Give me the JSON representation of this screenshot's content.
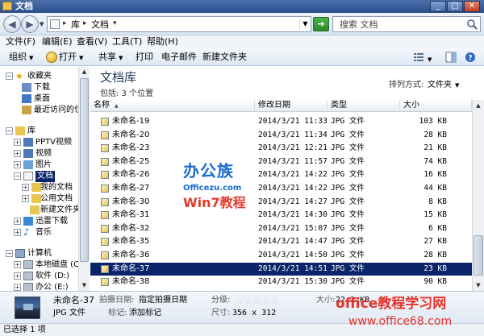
{
  "window": {
    "title": "文档"
  },
  "address": {
    "crumbs": [
      "库",
      "文档"
    ]
  },
  "search": {
    "placeholder": "搜索 文档"
  },
  "menu": [
    "文件(F)",
    "编辑(E)",
    "查看(V)",
    "工具(T)",
    "帮助(H)"
  ],
  "commands": {
    "organize": "组织",
    "open": "打开",
    "share": "共享",
    "print": "打印",
    "email": "电子邮件",
    "new_folder": "新建文件夹"
  },
  "nav": {
    "favorites": "收藏夹",
    "downloads": "下载",
    "desktop": "桌面",
    "recent": "最近访问的位置",
    "libraries": "库",
    "pptv": "PPTV视频",
    "videos": "视频",
    "pictures": "图片",
    "documents": "文档",
    "my_documents": "我的文档",
    "public_documents": "公用文档",
    "new_folder": "新建文件夹",
    "xunlei": "迅雷下载",
    "music": "音乐",
    "computer": "计算机",
    "local_disk": "本地磁盘 (C:)",
    "software": "软件 (D:)",
    "office": "办公 (E:)"
  },
  "library": {
    "title": "文档库",
    "includes": "包括: 3 个位置",
    "arrange_label": "排列方式:",
    "arrange_value": "文件夹"
  },
  "columns": {
    "name": "名称",
    "date": "修改日期",
    "type": "类型",
    "size": "大小"
  },
  "files": [
    {
      "name": "未命名-19",
      "date": "2014/3/21 11:33",
      "type": "JPG 文件",
      "size": "103 KB"
    },
    {
      "name": "未命名-20",
      "date": "2014/3/21 11:34",
      "type": "JPG 文件",
      "size": "28 KB"
    },
    {
      "name": "未命名-23",
      "date": "2014/3/21 12:21",
      "type": "JPG 文件",
      "size": "21 KB"
    },
    {
      "name": "未命名-25",
      "date": "2014/3/21 11:57",
      "type": "JPG 文件",
      "size": "74 KB"
    },
    {
      "name": "未命名-26",
      "date": "2014/3/21 14:22",
      "type": "JPG 文件",
      "size": "16 KB"
    },
    {
      "name": "未命名-27",
      "date": "2014/3/21 14:22",
      "type": "JPG 文件",
      "size": "44 KB"
    },
    {
      "name": "未命名-30",
      "date": "2014/3/21 14:27",
      "type": "JPG 文件",
      "size": "8 KB"
    },
    {
      "name": "未命名-31",
      "date": "2014/3/21 14:30",
      "type": "JPG 文件",
      "size": "15 KB"
    },
    {
      "name": "未命名-32",
      "date": "2014/3/21 15:07",
      "type": "JPG 文件",
      "size": "6 KB"
    },
    {
      "name": "未命名-35",
      "date": "2014/3/21 14:47",
      "type": "JPG 文件",
      "size": "27 KB"
    },
    {
      "name": "未命名-36",
      "date": "2014/3/21 14:50",
      "type": "JPG 文件",
      "size": "28 KB"
    },
    {
      "name": "未命名-37",
      "date": "2014/3/21 14:51",
      "type": "JPG 文件",
      "size": "23 KB"
    },
    {
      "name": "未命名-38",
      "date": "2014/3/21 15:30",
      "type": "JPG 文件",
      "size": "90 KB"
    }
  ],
  "selected_index": 11,
  "details": {
    "name": "未命名-37",
    "date_label": "拍摄日期:",
    "date_value": "指定拍摄日期",
    "type": "JPG 文件",
    "tags_label": "标记:",
    "tags_value": "添加标记",
    "rating_label": "分级:",
    "rating_stars": "☆☆☆☆☆",
    "size_label": "大小:",
    "size_value": "22.1 KB",
    "dims_label": "尺寸:",
    "dims_value": "356 x 312"
  },
  "status": {
    "text": "已选择 1 项"
  },
  "watermark": {
    "big": "办公族",
    "site": "Officezu.com",
    "win7": "Win7教程"
  },
  "brand": {
    "title": "office教程学习网",
    "url": "www.office68.com"
  },
  "colors": {
    "selection": "#0a246a",
    "title_bar": "#2c4f8e",
    "brand_red": "#e6332a"
  }
}
